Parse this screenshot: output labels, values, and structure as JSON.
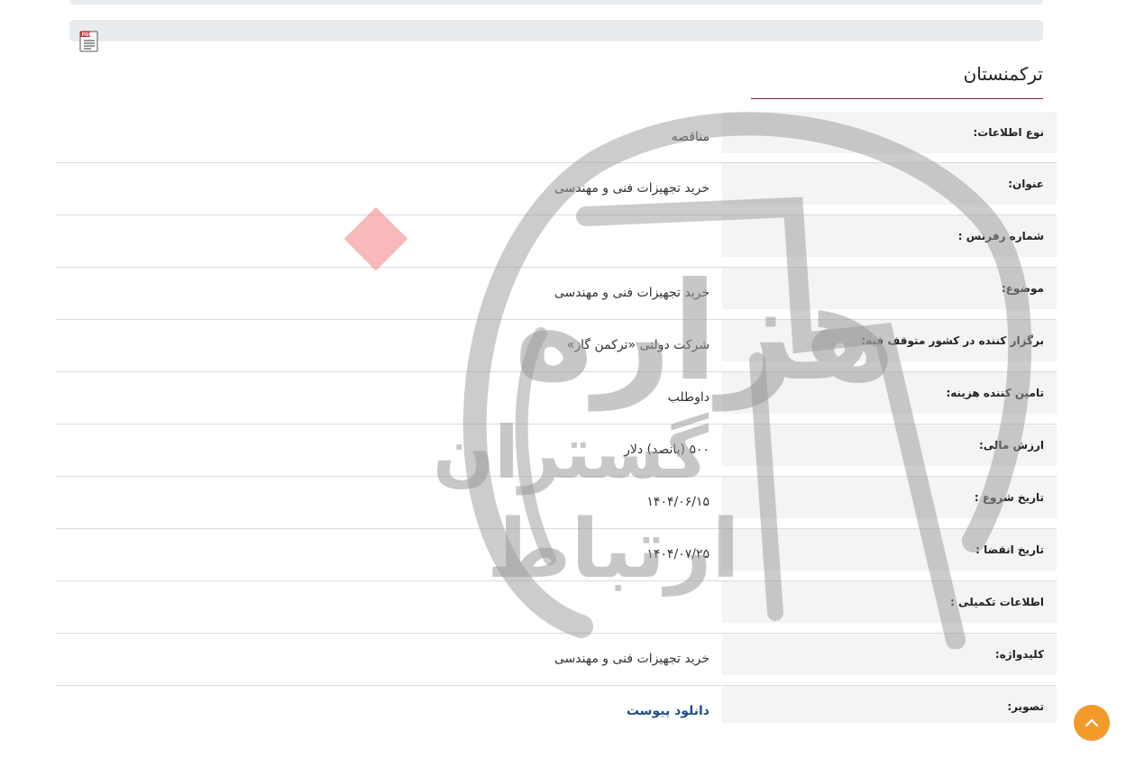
{
  "header": {
    "country": "ترکمنستان"
  },
  "rows": [
    {
      "label": "نوع اطلاعات:",
      "value": "مناقصه"
    },
    {
      "label": "عنوان:",
      "value": "خرید تجهیزات فنی و مهندسی"
    },
    {
      "label": "شماره رفرنس :",
      "value": ""
    },
    {
      "label": "موضوع:",
      "value": "خرید تجهیزات فنی و مهندسی"
    },
    {
      "label": "برگزار کننده در کشور متوقف فیه:",
      "value": "شرکت دولتی «ترکمن گاز»"
    },
    {
      "label": "تامین کننده هزینه:",
      "value": "داوطلب"
    },
    {
      "label": "ارزش مالی:",
      "value": "۵۰۰ (پانصد) دلار"
    },
    {
      "label": "تاریخ شروع :",
      "value": "۱۴۰۴/۰۶/۱۵"
    },
    {
      "label": "تاریخ انقضا :",
      "value": "۱۴۰۴/۰۷/۲۵"
    },
    {
      "label": "اطلاعات تکمیلی :",
      "value": ""
    },
    {
      "label": "کلیدواژه:",
      "value": "خرید تجهیزات فنی و مهندسی"
    },
    {
      "label": "تصویر:",
      "value": "دانلود پیوست"
    }
  ],
  "watermark": {
    "line1": "هزاره",
    "line2": "گستران",
    "line3": "ارتباط"
  },
  "icons": {
    "pdf": "pdf-icon",
    "scroll_top": "chevron-up-icon"
  },
  "colors": {
    "underline": "#8b1a4a",
    "link": "#1f4e86",
    "scroll_button": "#f39a2b",
    "watermark": "#9a9a9a",
    "watermark_accent": "#f08080"
  }
}
